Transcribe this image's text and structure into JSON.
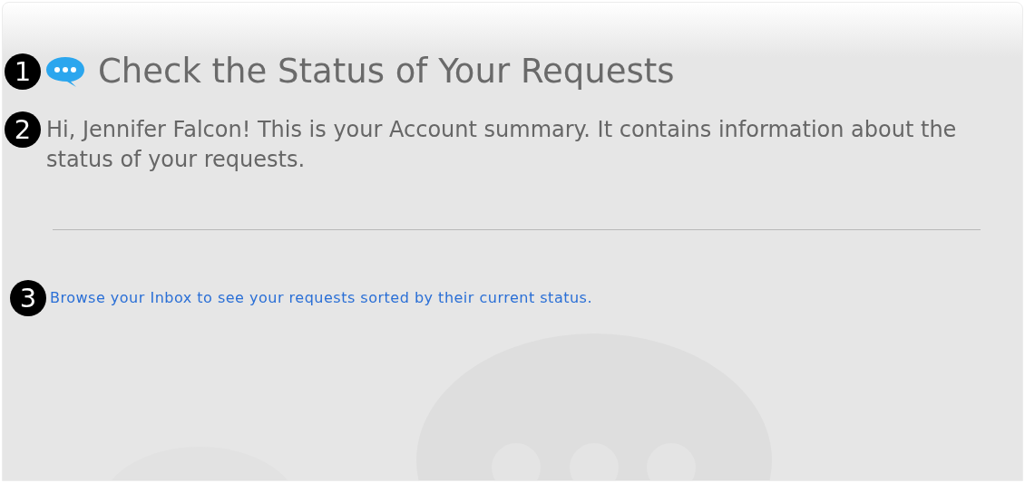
{
  "title": {
    "marker": "1",
    "text": "Check the Status of Your Requests"
  },
  "summary": {
    "marker": "2",
    "text": "Hi, Jennifer Falcon! This is your Account summary. It contains information about the status of your requests."
  },
  "inbox_link": {
    "marker": "3",
    "text": "Browse your Inbox to see your requests sorted by their current status."
  }
}
